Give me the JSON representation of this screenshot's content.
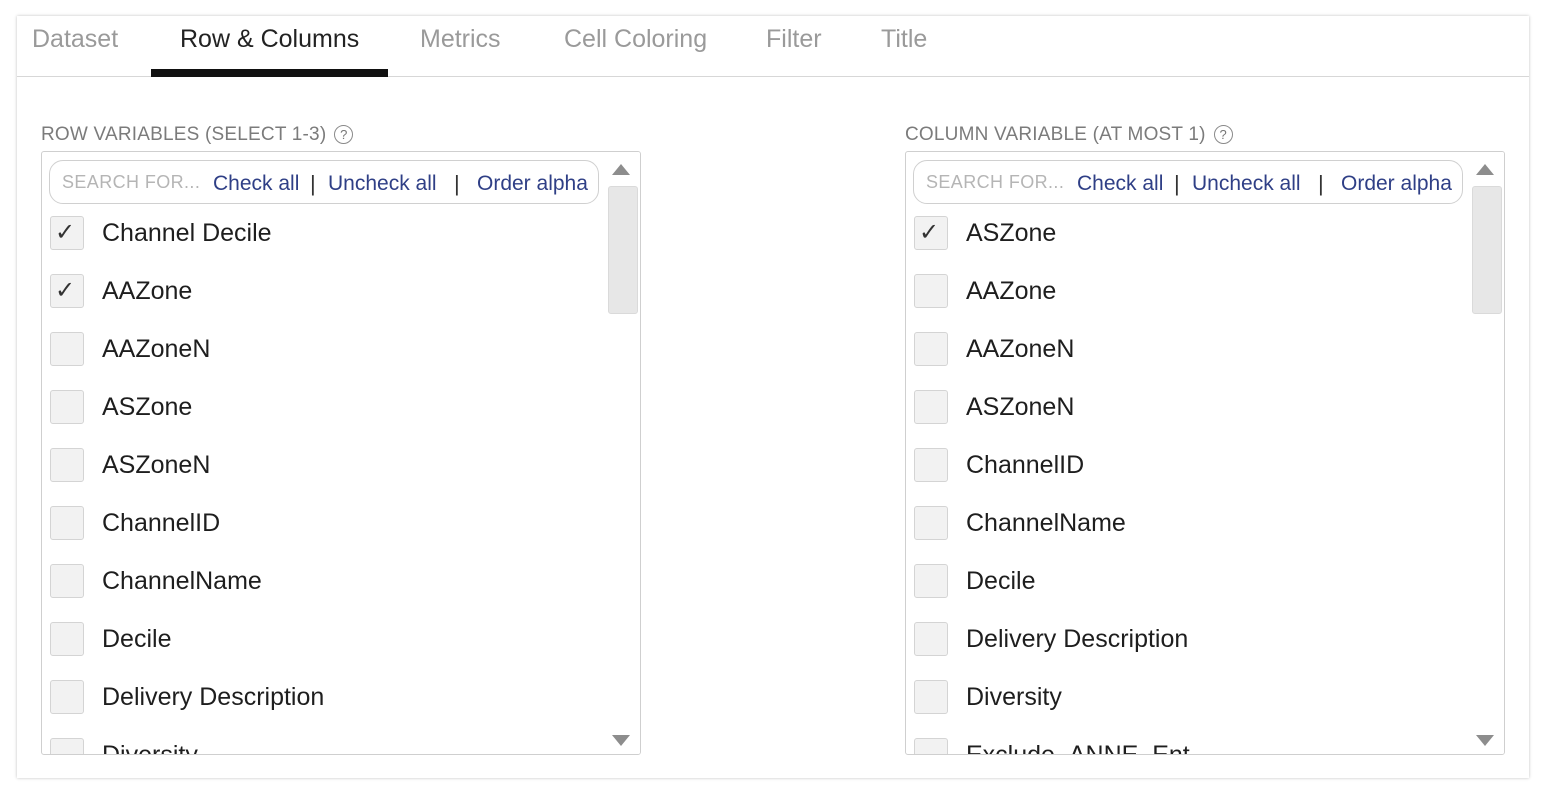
{
  "tabs": [
    {
      "label": "Dataset",
      "active": false
    },
    {
      "label": "Row & Columns",
      "active": true
    },
    {
      "label": "Metrics",
      "active": false
    },
    {
      "label": "Cell Coloring",
      "active": false
    },
    {
      "label": "Filter",
      "active": false
    },
    {
      "label": "Title",
      "active": false
    }
  ],
  "row_panel": {
    "label": "ROW VARIABLES (SELECT 1-3)",
    "search_placeholder": "SEARCH FOR...",
    "check_all": "Check all",
    "uncheck_all": "Uncheck all",
    "order_alpha": "Order alpha",
    "separator": "|",
    "items": [
      {
        "label": "Channel Decile",
        "checked": true
      },
      {
        "label": "AAZone",
        "checked": true
      },
      {
        "label": "AAZoneN",
        "checked": false
      },
      {
        "label": "ASZone",
        "checked": false
      },
      {
        "label": "ASZoneN",
        "checked": false
      },
      {
        "label": "ChannelID",
        "checked": false
      },
      {
        "label": "ChannelName",
        "checked": false
      },
      {
        "label": "Decile",
        "checked": false
      },
      {
        "label": "Delivery Description",
        "checked": false
      },
      {
        "label": "Diversity",
        "checked": false
      }
    ]
  },
  "column_panel": {
    "label": "COLUMN VARIABLE (AT MOST 1)",
    "search_placeholder": "SEARCH FOR...",
    "check_all": "Check all",
    "uncheck_all": "Uncheck all",
    "order_alpha": "Order alpha",
    "separator": "|",
    "items": [
      {
        "label": "ASZone",
        "checked": true
      },
      {
        "label": "AAZone",
        "checked": false
      },
      {
        "label": "AAZoneN",
        "checked": false
      },
      {
        "label": "ASZoneN",
        "checked": false
      },
      {
        "label": "ChannelID",
        "checked": false
      },
      {
        "label": "ChannelName",
        "checked": false
      },
      {
        "label": "Decile",
        "checked": false
      },
      {
        "label": "Delivery Description",
        "checked": false
      },
      {
        "label": "Diversity",
        "checked": false
      },
      {
        "label": "Exclude_ANNE_Ent",
        "checked": false
      }
    ]
  },
  "help_glyph": "?",
  "check_glyph": "✓"
}
